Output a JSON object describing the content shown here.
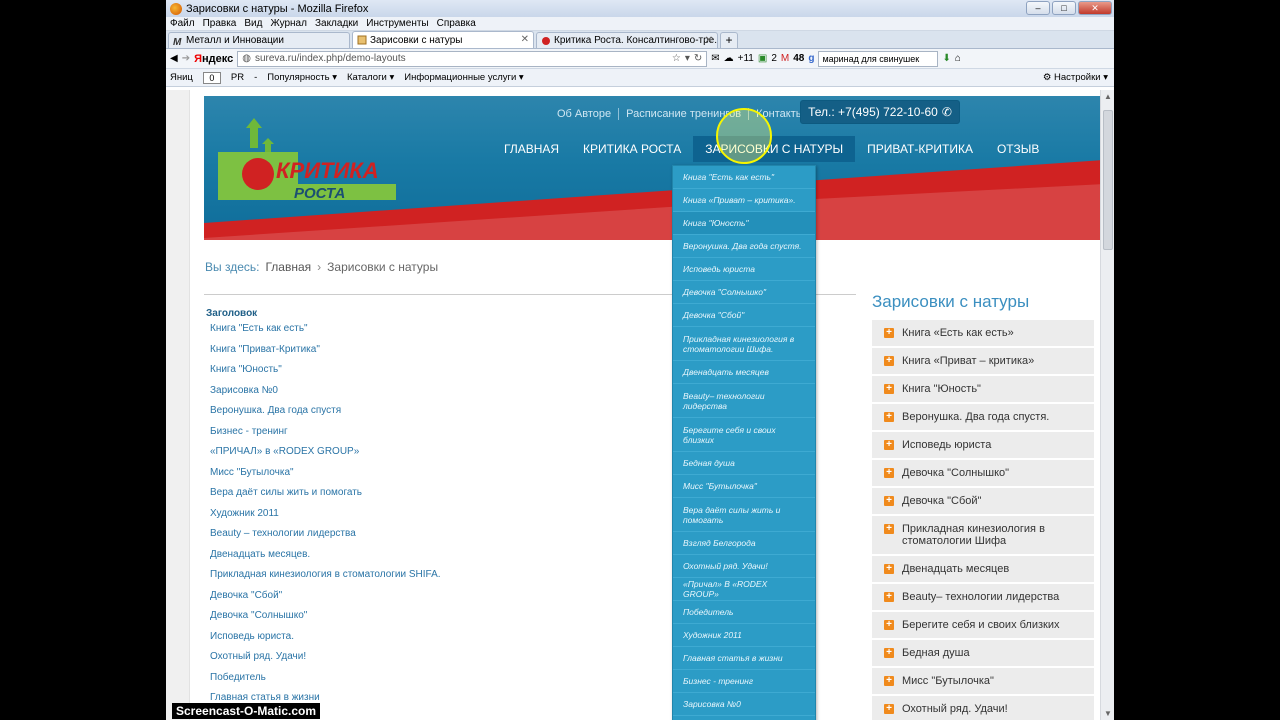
{
  "window": {
    "title": "Зарисовки с натуры - Mozilla Firefox",
    "controls": {
      "minimize": "–",
      "maximize": "□",
      "close": "✕"
    }
  },
  "menu": [
    "Файл",
    "Правка",
    "Вид",
    "Журнал",
    "Закладки",
    "Инструменты",
    "Справка"
  ],
  "tabs": [
    {
      "label": "Металл и Инновации",
      "active": false
    },
    {
      "label": "Зарисовки с натуры",
      "active": true
    },
    {
      "label": "Критика Роста. Консалтингово-тре...",
      "active": false
    }
  ],
  "navbar": {
    "yandex_logo_first": "Я",
    "yandex_logo_rest": "ндекс",
    "url": "sureva.ru/index.php/demo-layouts",
    "weather": "+11",
    "mail_count": "2",
    "gmail_count": "48",
    "search_value": "маринад для свинушек"
  },
  "ytoolbar": {
    "tic_label": "Яниц",
    "tic_value": "0",
    "pr_label": "PR",
    "pr_value": "-",
    "items": [
      "Популярность",
      "Каталоги",
      "Информационные услуги"
    ],
    "settings": "Настройки"
  },
  "site": {
    "logo_top": "КРИТИКА",
    "logo_bottom": "РОСТА",
    "toplinks": [
      "Об Авторе",
      "Расписание тренингов",
      "Контакты"
    ],
    "phone": "Тел.: +7(495) 722-10-60",
    "mainnav": [
      {
        "label": "ГЛАВНАЯ"
      },
      {
        "label": "КРИТИКА РОСТА"
      },
      {
        "label": "ЗАРИСОВКИ С НАТУРЫ",
        "active": true
      },
      {
        "label": "ПРИВАТ-КРИТИКА"
      },
      {
        "label": "ОТЗЫВ"
      }
    ]
  },
  "breadcrumb": {
    "prefix": "Вы здесь:",
    "home": "Главная",
    "separator": "›",
    "current": "Зарисовки с натуры"
  },
  "leftlist": {
    "heading": "Заголовок",
    "items": [
      "Книга \"Есть как есть\"",
      "Книга \"Приват-Критика\"",
      "Книга \"Юность\"",
      "Зарисовка №0",
      "Веронушка. Два года спустя",
      "Бизнес - тренинг",
      "«ПРИЧАЛ» в «RODEX GROUP»",
      "Мисс \"Бутылочка\"",
      "Вера даёт силы жить и помогать",
      "Художник 2011",
      "Beauty – технологии лидерства",
      "Двенадцать месяцев.",
      "Прикладная кинезиология в стоматологии SHIFA.",
      "Девочка \"Сбой\"",
      "Девочка \"Солнышко\"",
      "Исповедь юриста.",
      "Охотный ряд. Удачи!",
      "Победитель",
      "Главная статья в жизни"
    ]
  },
  "dropdown": {
    "items": [
      {
        "label": "Книга \"Есть как есть\"",
        "h": 23
      },
      {
        "label": "Книга «Приват – критика».",
        "h": 23
      },
      {
        "label": "Книга \"Юность\"",
        "h": 23,
        "highlight": true
      },
      {
        "label": "Веронушка. Два года спустя.",
        "h": 23
      },
      {
        "label": "Исповедь юриста",
        "h": 23
      },
      {
        "label": "Девочка \"Солнышко\"",
        "h": 23
      },
      {
        "label": "Девочка \"Сбой\"",
        "h": 23
      },
      {
        "label": "Прикладная кинезиология в стоматологии Шифа.",
        "h": 34
      },
      {
        "label": "Двенадцать месяцев",
        "h": 23
      },
      {
        "label": "Beauty– технологии лидерства",
        "h": 34
      },
      {
        "label": "Берегите себя и своих близких",
        "h": 34
      },
      {
        "label": "Бедная душа",
        "h": 23
      },
      {
        "label": "Мисс \"Бутылочка\"",
        "h": 23
      },
      {
        "label": "Вера даёт силы жить и помогать",
        "h": 34
      },
      {
        "label": "Взгляд Белгорода",
        "h": 23
      },
      {
        "label": "Охотный ряд. Удачи!",
        "h": 23
      },
      {
        "label": "«Причал» В «RODEX GROUP»",
        "h": 23
      },
      {
        "label": "Победитель",
        "h": 23
      },
      {
        "label": "Художник 2011",
        "h": 23
      },
      {
        "label": "Главная статья в жизни",
        "h": 23
      },
      {
        "label": "Бизнес - тренинг",
        "h": 23
      },
      {
        "label": "Зарисовка №0",
        "h": 23
      }
    ]
  },
  "sidebar": {
    "title": "Зарисовки с натуры",
    "items": [
      "Книга «Есть как есть»",
      "Книга «Приват – критика»",
      "Книга \"Юность\"",
      "Веронушка. Два года спустя.",
      "Исповедь юриста",
      "Девочка \"Солнышко\"",
      "Девочка \"Сбой\"",
      "Прикладная кинезиология в стоматологии Шифа",
      "Двенадцать месяцев",
      "Beauty– технологии лидерства",
      "Берегите себя и своих близких",
      "Бедная душа",
      "Мисс \"Бутылочка\"",
      "Охотный ряд. Удачи!"
    ]
  },
  "watermark": "Screencast-O-Matic.com",
  "colors": {
    "header_blue": "#197aa5",
    "header_red": "#d02222",
    "dropdown_bg": "#2c9cc6",
    "accent_orange": "#f08a1c",
    "link_blue": "#2a74a6"
  }
}
